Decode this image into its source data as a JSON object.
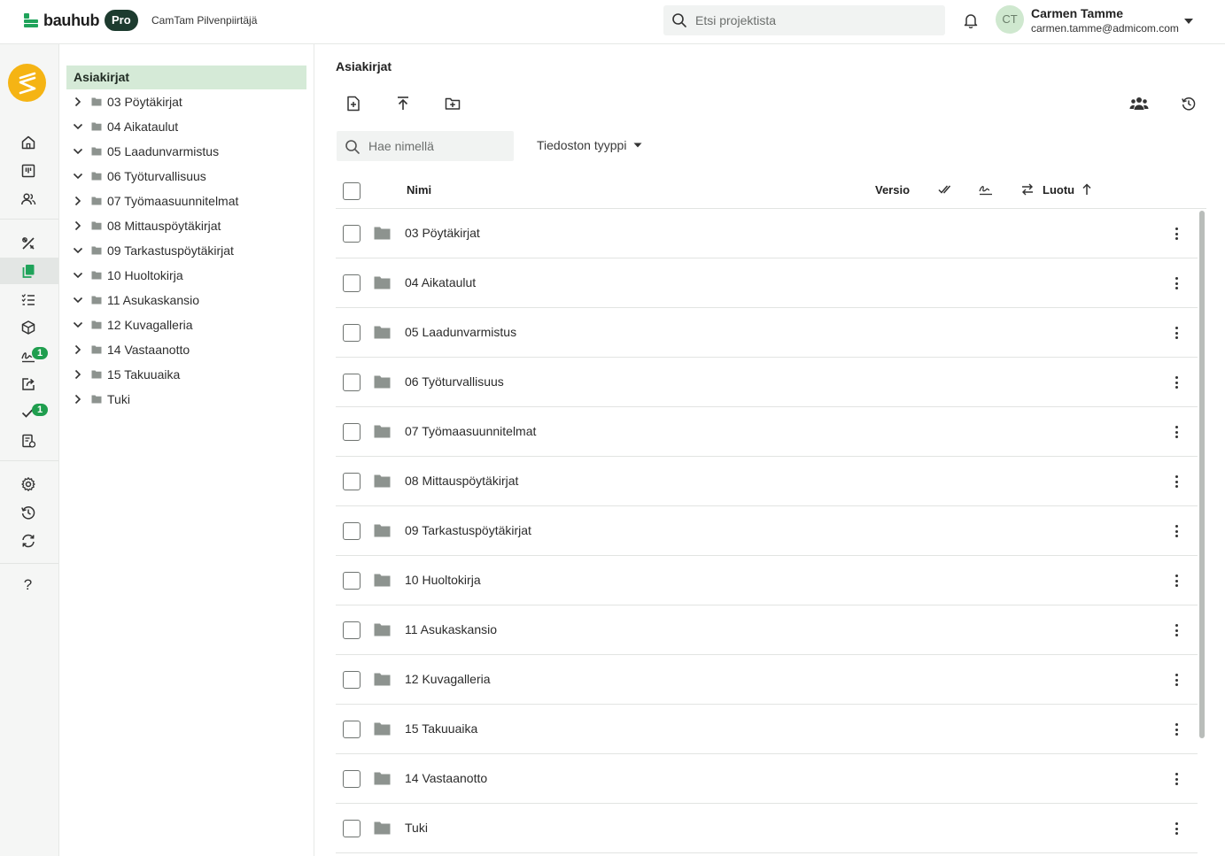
{
  "header": {
    "brand": "bauhub",
    "badge": "Pro",
    "project": "CamTam Pilvenpiirtäjä",
    "search_placeholder": "Etsi projektista",
    "user": {
      "initials": "CT",
      "name": "Carmen Tamme",
      "email": "carmen.tamme@admicom.com"
    }
  },
  "rail": {
    "badges": {
      "signatures": "1",
      "approvals": "1"
    },
    "help": "?"
  },
  "tree": {
    "root": "Asiakirjat",
    "items": [
      {
        "label": "03 Pöytäkirjat",
        "expanded": false
      },
      {
        "label": "04 Aikataulut",
        "expanded": true
      },
      {
        "label": "05 Laadunvarmistus",
        "expanded": true
      },
      {
        "label": "06 Työturvallisuus",
        "expanded": true
      },
      {
        "label": "07 Työmaasuunnitelmat",
        "expanded": false
      },
      {
        "label": "08 Mittauspöytäkirjat",
        "expanded": false
      },
      {
        "label": "09 Tarkastuspöytäkirjat",
        "expanded": true
      },
      {
        "label": "10 Huoltokirja",
        "expanded": true
      },
      {
        "label": "11 Asukaskansio",
        "expanded": true
      },
      {
        "label": "12 Kuvagalleria",
        "expanded": true
      },
      {
        "label": "14 Vastaanotto",
        "expanded": false
      },
      {
        "label": "15 Takuuaika",
        "expanded": false
      },
      {
        "label": "Tuki",
        "expanded": false
      }
    ]
  },
  "main": {
    "title": "Asiakirjat",
    "search_placeholder": "Hae nimellä",
    "filetype_label": "Tiedoston tyyppi",
    "columns": {
      "name": "Nimi",
      "version": "Versio",
      "created": "Luotu"
    },
    "rows": [
      "03 Pöytäkirjat",
      "04 Aikataulut",
      "05 Laadunvarmistus",
      "06 Työturvallisuus",
      "07 Työmaasuunnitelmat",
      "08 Mittauspöytäkirjat",
      "09 Tarkastuspöytäkirjat",
      "10 Huoltokirja",
      "11 Asukaskansio",
      "12 Kuvagalleria",
      "15 Takuuaika",
      "14 Vastaanotto",
      "Tuki"
    ]
  },
  "colors": {
    "accent": "#1fa35a",
    "selected_bg": "#d5ead7",
    "badge": "#1f9e4e",
    "logo_circle": "#f5b414"
  }
}
